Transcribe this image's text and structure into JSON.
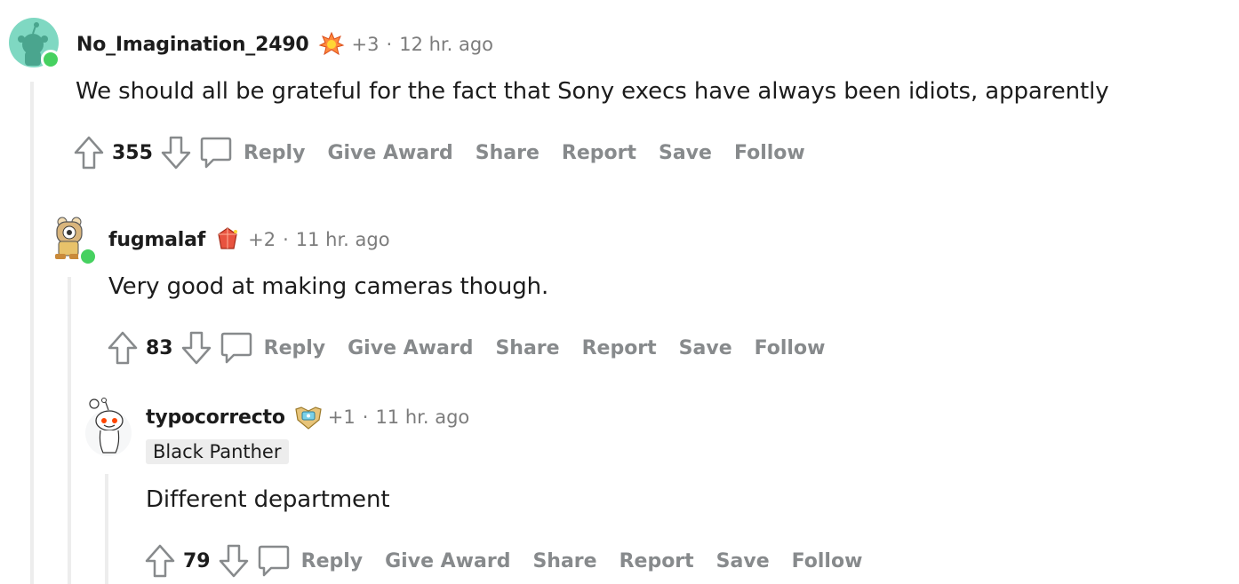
{
  "comments": [
    {
      "username": "No_Imagination_2490",
      "award_count": "+3",
      "separator": "·",
      "timestamp": "12 hr. ago",
      "body": "We should all be grateful for the fact that Sony execs have always been idiots, apparently",
      "score": "355",
      "flair": null,
      "avatar_icon": "snoo-avatar-icon",
      "award_icon": "flame-award-icon"
    },
    {
      "username": "fugmalaf",
      "award_count": "+2",
      "separator": "·",
      "timestamp": "11 hr. ago",
      "body": "Very good at making cameras though.",
      "score": "83",
      "flair": null,
      "avatar_icon": "bear-avatar-icon",
      "award_icon": "gem-award-icon"
    },
    {
      "username": "typocorrecto",
      "award_count": "+1",
      "separator": "·",
      "timestamp": "11 hr. ago",
      "flair": "Black Panther",
      "body": "Different department",
      "score": "79",
      "avatar_icon": "snoo-default-avatar-icon",
      "award_icon": "shield-award-icon"
    }
  ],
  "actions": {
    "reply": "Reply",
    "give_award": "Give Award",
    "share": "Share",
    "report": "Report",
    "save": "Save",
    "follow": "Follow"
  },
  "colors": {
    "online": "#46d160",
    "muted_text": "#878a8c",
    "thread_line": "#ededed",
    "avatar_teal": "#7fd8c2"
  }
}
